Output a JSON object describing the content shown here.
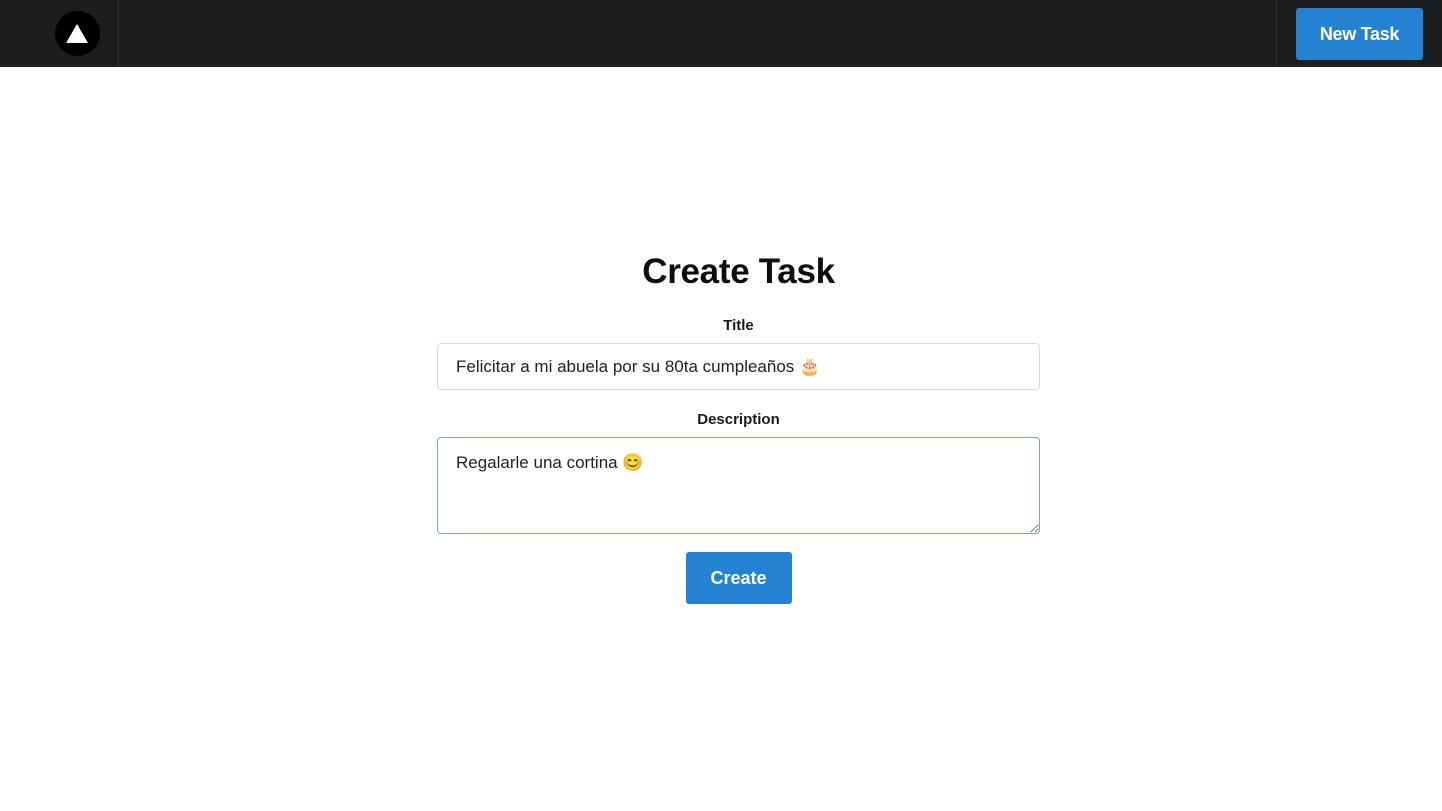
{
  "navbar": {
    "logo_icon": "triangle-logo-icon",
    "new_task_label": "New Task",
    "background": "#1c1d1f",
    "accent": "#2582d3"
  },
  "form": {
    "title": "Create Task",
    "title_label": "Title",
    "title_value": "Felicitar a mi abuela por su 80ta cumpleaños 🎂",
    "description_label": "Description",
    "description_value": "Regalarle una cortina 😊",
    "submit_label": "Create"
  }
}
